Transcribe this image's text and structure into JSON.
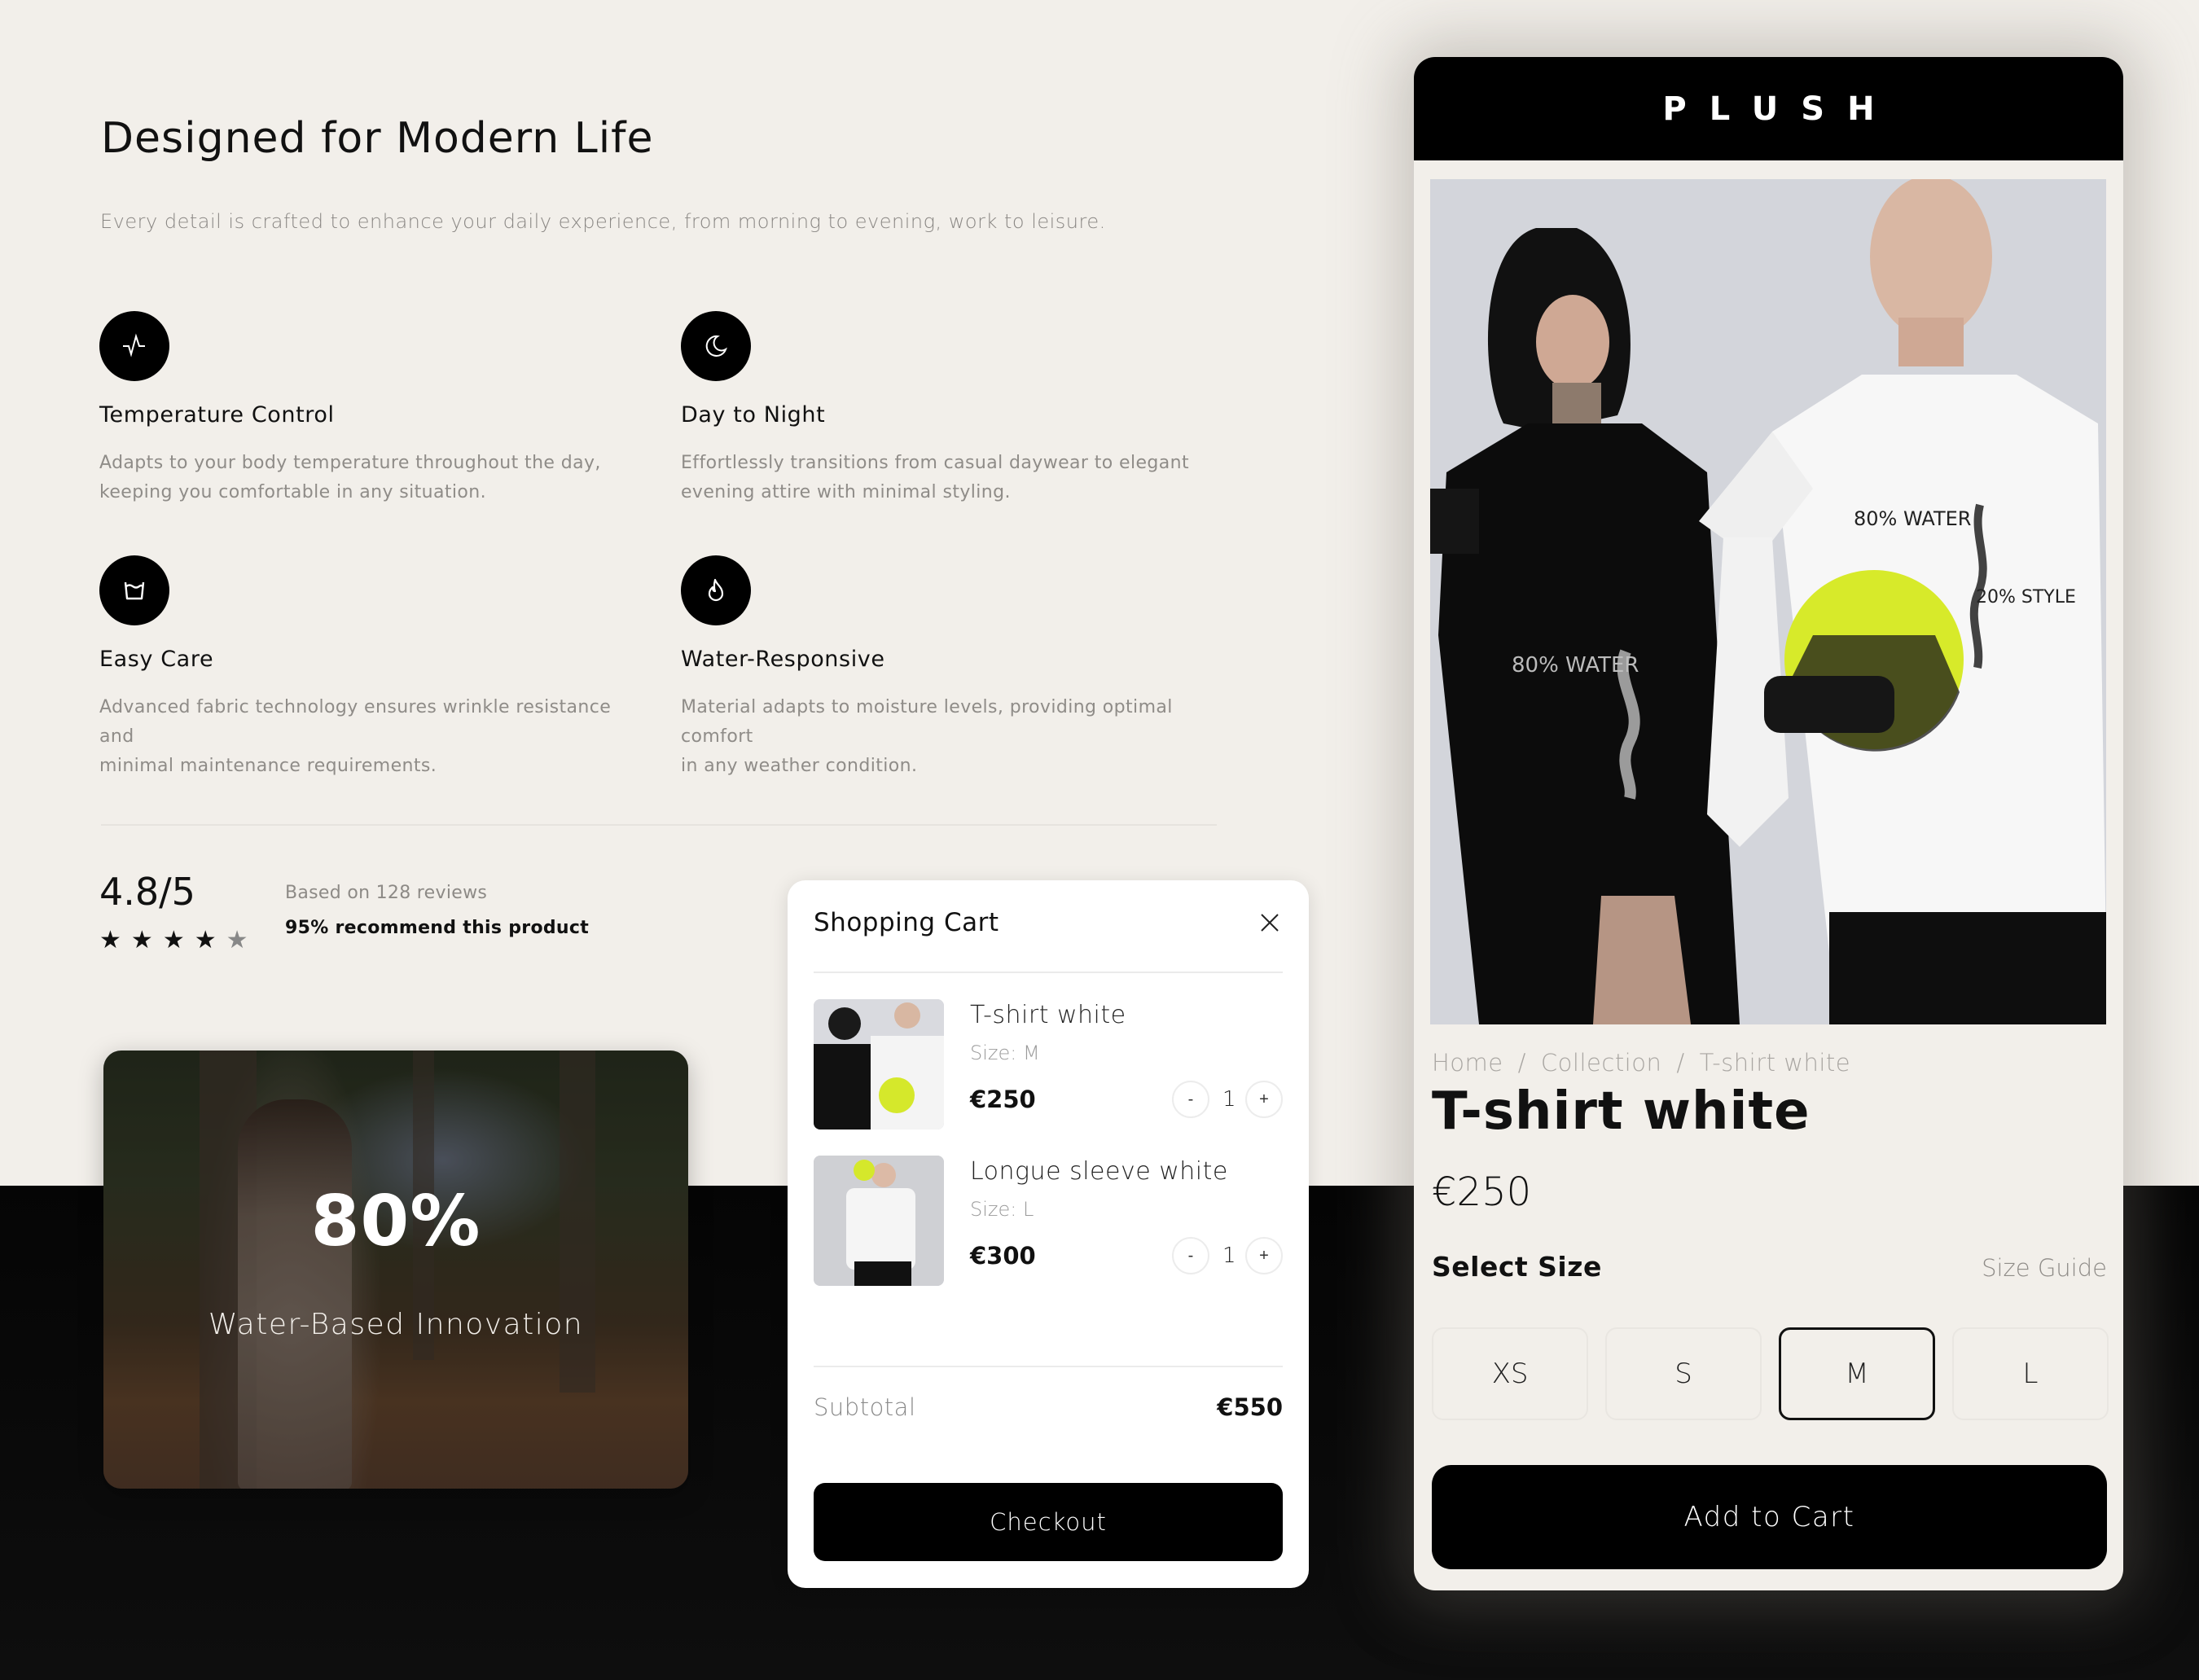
{
  "features_section": {
    "title": "Designed for Modern Life",
    "subtitle": "Every detail is crafted to enhance your daily experience, from morning to evening, work to leisure.",
    "features": [
      {
        "icon": "pulse-icon",
        "title": "Temperature Control",
        "description_line1": "Adapts to your body temperature throughout the day,",
        "description_line2": "keeping you comfortable in any situation."
      },
      {
        "icon": "moon-icon",
        "title": "Day to Night",
        "description_line1": "Effortlessly transitions from casual daywear to elegant",
        "description_line2": "evening attire with minimal styling."
      },
      {
        "icon": "wash-basin-icon",
        "title": "Easy Care",
        "description_line1": "Advanced fabric technology ensures wrinkle resistance and",
        "description_line2": "minimal maintenance requirements."
      },
      {
        "icon": "flame-icon",
        "title": "Water-Responsive",
        "description_line1": "Material adapts to moisture levels, providing optimal comfort",
        "description_line2": "in any weather condition."
      }
    ]
  },
  "rating": {
    "value": "4.8/5",
    "stars_filled": 4,
    "stars_total": 5,
    "review_count": "Based on 128 reviews",
    "recommend": "95% recommend this product"
  },
  "promo": {
    "headline": "80%",
    "subtitle": "Water-Based Innovation"
  },
  "cart": {
    "title": "Shopping Cart",
    "items": [
      {
        "name": "T-shirt white",
        "size": "Size: M",
        "price": "€250",
        "quantity": "1",
        "decrement": "-",
        "increment": "+"
      },
      {
        "name": "Longue sleeve white",
        "size": "Size: L",
        "price": "€300",
        "quantity": "1",
        "decrement": "-",
        "increment": "+"
      }
    ],
    "subtotal_label": "Subtotal",
    "subtotal_value": "€550",
    "checkout_label": "Checkout"
  },
  "product": {
    "brand": "PLUSH",
    "breadcrumb": [
      "Home",
      "Collection",
      "T-shirt white"
    ],
    "breadcrumb_separator": "/",
    "title": "T-shirt white",
    "price": "€250",
    "select_size_label": "Select Size",
    "size_guide_label": "Size Guide",
    "sizes": [
      "XS",
      "S",
      "M",
      "L"
    ],
    "selected_size": "M",
    "add_to_cart_label": "Add to Cart",
    "shirt_print_1": "80% WATER",
    "shirt_print_2": "20% STYLE"
  },
  "colors": {
    "background_light": "#f2efea",
    "background_dark": "#050505",
    "accent": "#000000",
    "muted_text": "#8f8c88"
  }
}
